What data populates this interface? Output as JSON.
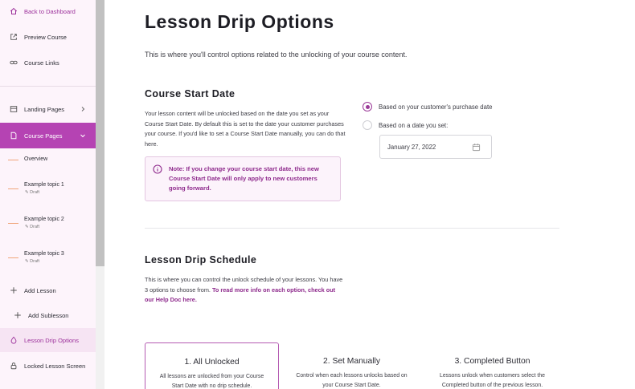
{
  "sidebar": {
    "top_items": [
      {
        "label": "Back to Dashboard",
        "icon": "home-icon"
      },
      {
        "label": "Preview Course",
        "icon": "external-link-icon"
      },
      {
        "label": "Course Links",
        "icon": "link-icon"
      }
    ],
    "landing_pages": {
      "label": "Landing Pages",
      "icon": "layout-icon"
    },
    "course_pages": {
      "label": "Course Pages",
      "icon": "page-icon"
    },
    "overview": {
      "label": "Overview"
    },
    "topics": [
      {
        "label": "Example topic 1",
        "status": "Draft"
      },
      {
        "label": "Example topic 2",
        "status": "Draft"
      },
      {
        "label": "Example topic 3",
        "status": "Draft"
      }
    ],
    "add_lesson": "Add Lesson",
    "add_sublesson": "Add Sublesson",
    "lesson_drip": "Lesson Drip Options",
    "locked_screen": "Locked Lesson Screen"
  },
  "main": {
    "title": "Lesson Drip Options",
    "intro": "This is where you'll control options related to the unlocking of your course content.",
    "start_date": {
      "heading": "Course Start Date",
      "description": "Your lesson content will be unlocked based on the date you set as your Course Start Date. By default this is set to the date your customer purchases your course. If you'd like to set a Course Start Date manually, you can do that here.",
      "note": "Note: If you change your course start date, this new Course Start Date will only apply to new customers going forward.",
      "options": [
        {
          "label": "Based on your customer's purchase date",
          "checked": true
        },
        {
          "label": "Based on a date you set:",
          "checked": false
        }
      ],
      "date_value": "January 27, 2022"
    },
    "schedule": {
      "heading": "Lesson Drip Schedule",
      "description": "This is where you can control the unlock schedule of your lessons. You have 3 options to choose from.",
      "link_text": "To read more info on each option, check out our Help Doc here.",
      "cards": [
        {
          "title": "1. All Unlocked",
          "description": "All lessons are unlocked from your Course Start Date with no drip schedule.",
          "selected": true
        },
        {
          "title": "2. Set Manually",
          "description": "Control when each lessons unlocks based on your Course Start Date.",
          "selected": false
        },
        {
          "title": "3. Completed Button",
          "description": "Lessons unlock when customers select the Completed button of the previous lesson.",
          "selected": false
        }
      ]
    }
  },
  "colors": {
    "accent": "#b543b3",
    "accent_dark": "#8e2a8c",
    "sidebar_bg": "#fdf4fb",
    "draft_line": "#f0a57a"
  }
}
